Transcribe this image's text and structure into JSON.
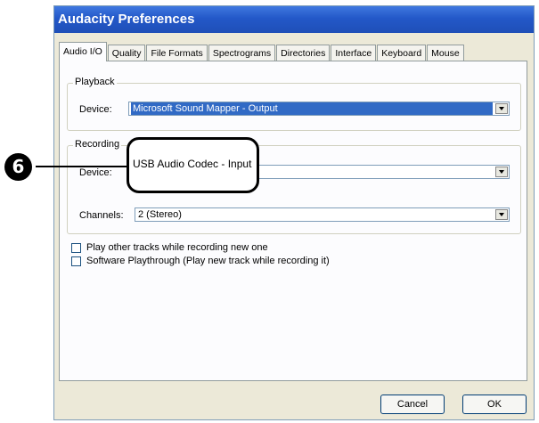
{
  "window": {
    "title": "Audacity Preferences"
  },
  "tabs": [
    {
      "label": "Audio I/O",
      "active": true
    },
    {
      "label": "Quality"
    },
    {
      "label": "File Formats"
    },
    {
      "label": "Spectrograms"
    },
    {
      "label": "Directories"
    },
    {
      "label": "Interface"
    },
    {
      "label": "Keyboard"
    },
    {
      "label": "Mouse"
    }
  ],
  "playback": {
    "group_label": "Playback",
    "device_label": "Device:",
    "device_value": "Microsoft Sound Mapper - Output"
  },
  "recording": {
    "group_label": "Recording",
    "device_label": "Device:",
    "device_value": "USB Audio Codec - Input",
    "channels_label": "Channels:",
    "channels_value": "2 (Stereo)"
  },
  "options": [
    "Play other tracks while recording new one",
    "Software Playthrough (Play new track while recording it)"
  ],
  "buttons": {
    "cancel": "Cancel",
    "ok": "OK"
  },
  "callout": {
    "number": "6"
  }
}
